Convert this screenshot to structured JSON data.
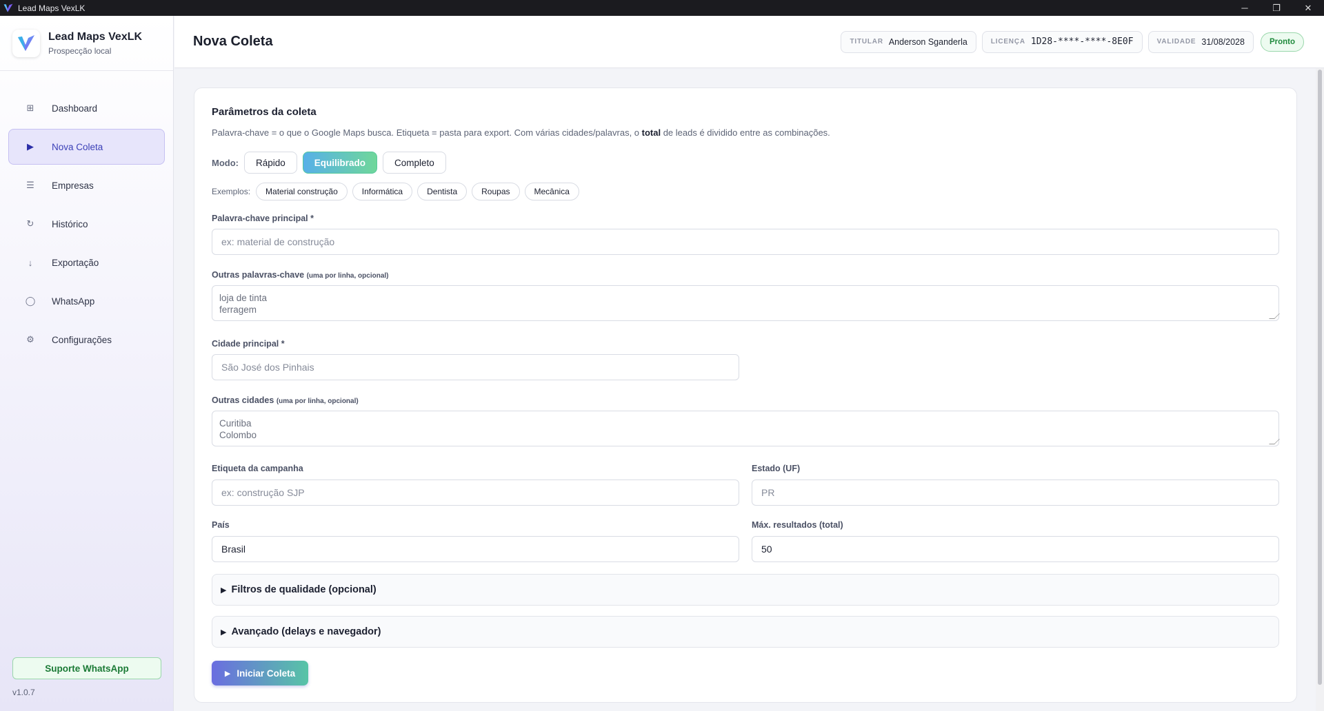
{
  "window": {
    "title": "Lead Maps VexLK",
    "minimize": "─",
    "restore": "❐",
    "close": "✕"
  },
  "brand": {
    "name": "Lead Maps VexLK",
    "subtitle": "Prospecção local"
  },
  "sidebar": {
    "items": [
      {
        "label": "Dashboard",
        "icon": "⊞",
        "active": false
      },
      {
        "label": "Nova Coleta",
        "icon": "▶",
        "active": true
      },
      {
        "label": "Empresas",
        "icon": "☰",
        "active": false
      },
      {
        "label": "Histórico",
        "icon": "↻",
        "active": false
      },
      {
        "label": "Exportação",
        "icon": "↓",
        "active": false
      },
      {
        "label": "WhatsApp",
        "icon": "◯",
        "active": false
      },
      {
        "label": "Configurações",
        "icon": "⚙",
        "active": false
      }
    ],
    "support_label": "Suporte WhatsApp",
    "version": "v1.0.7"
  },
  "header": {
    "title": "Nova Coleta",
    "titular_label": "TITULAR",
    "titular_value": "Anderson Sganderla",
    "licenca_label": "LICENÇA",
    "licenca_value": "1D28-****-****-8E0F",
    "validade_label": "VALIDADE",
    "validade_value": "31/08/2028",
    "status": "Pronto"
  },
  "form": {
    "section_title": "Parâmetros da coleta",
    "hint_before": "Palavra-chave = o que o Google Maps busca. Etiqueta = pasta para export. Com várias cidades/palavras, o ",
    "hint_bold": "total",
    "hint_after": " de leads é dividido entre as combinações.",
    "mode_label": "Modo:",
    "modes": [
      "Rápido",
      "Equilibrado",
      "Completo"
    ],
    "selected_mode": "Equilibrado",
    "examples_label": "Exemplos:",
    "examples": [
      "Material construção",
      "Informática",
      "Dentista",
      "Roupas",
      "Mecânica"
    ],
    "keyword_label": "Palavra-chave principal *",
    "keyword_placeholder": "ex: material de construção",
    "other_keywords_label": "Outras palavras-chave",
    "other_keywords_note": "(uma por linha, opcional)",
    "other_keywords_line1": "loja de tinta",
    "other_keywords_line2": "ferragem",
    "city_label": "Cidade principal *",
    "city_placeholder": "São José dos Pinhais",
    "other_cities_label": "Outras cidades",
    "other_cities_note": "(uma por linha, opcional)",
    "other_cities_line1": "Curitiba",
    "other_cities_line2": "Colombo",
    "campaign_label": "Etiqueta da campanha",
    "campaign_placeholder": "ex: construção SJP",
    "state_label": "Estado (UF)",
    "state_placeholder": "PR",
    "country_label": "País",
    "country_value": "Brasil",
    "max_label": "Máx. resultados (total)",
    "max_value": "50",
    "quality_filters": "Filtros de qualidade (opcional)",
    "advanced": "Avançado (delays e navegador)",
    "start_button": "Iniciar Coleta"
  },
  "colors": {
    "accent": "#3a3fb7",
    "success": "#1f8a3c",
    "gradient_start": "#6a6de0",
    "gradient_end": "#57c4a6"
  }
}
